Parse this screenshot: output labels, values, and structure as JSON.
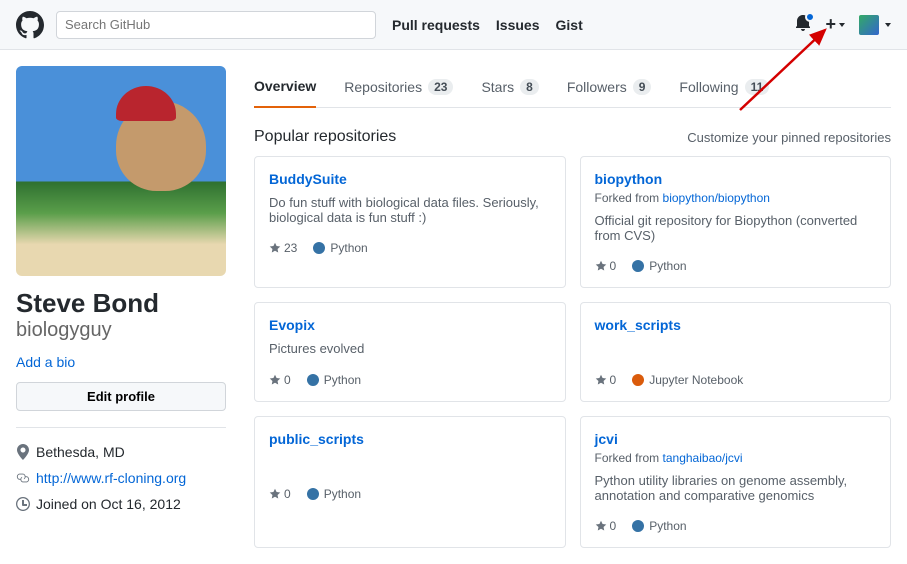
{
  "header": {
    "search_placeholder": "Search GitHub",
    "nav": {
      "pull": "Pull requests",
      "issues": "Issues",
      "gist": "Gist"
    }
  },
  "profile": {
    "name": "Steve Bond",
    "username": "biologyguy",
    "add_bio": "Add a bio",
    "edit_profile": "Edit profile",
    "location": "Bethesda, MD",
    "website": "http://www.rf-cloning.org",
    "joined": "Joined on Oct 16, 2012"
  },
  "tabs": {
    "overview": "Overview",
    "repositories": "Repositories",
    "repositories_count": "23",
    "stars": "Stars",
    "stars_count": "8",
    "followers": "Followers",
    "followers_count": "9",
    "following": "Following",
    "following_count": "11"
  },
  "popular": {
    "title": "Popular repositories",
    "customize": "Customize your pinned repositories",
    "forked_from": "Forked from"
  },
  "repos": {
    "r0": {
      "name": "BuddySuite",
      "desc": "Do fun stuff with biological data files. Seriously, biological data is fun stuff :)",
      "stars": "23",
      "lang": "Python"
    },
    "r1": {
      "name": "biopython",
      "fork": "biopython/biopython",
      "desc": "Official git repository for Biopython (converted from CVS)",
      "stars": "0",
      "lang": "Python"
    },
    "r2": {
      "name": "Evopix",
      "desc": "Pictures evolved",
      "stars": "0",
      "lang": "Python"
    },
    "r3": {
      "name": "work_scripts",
      "desc": "",
      "stars": "0",
      "lang": "Jupyter Notebook"
    },
    "r4": {
      "name": "public_scripts",
      "desc": "",
      "stars": "0",
      "lang": "Python"
    },
    "r5": {
      "name": "jcvi",
      "fork": "tanghaibao/jcvi",
      "desc": "Python utility libraries on genome assembly, annotation and comparative genomics",
      "stars": "0",
      "lang": "Python"
    }
  },
  "colors": {
    "python": "#3572A5",
    "jupyter": "#DA5B0B"
  }
}
